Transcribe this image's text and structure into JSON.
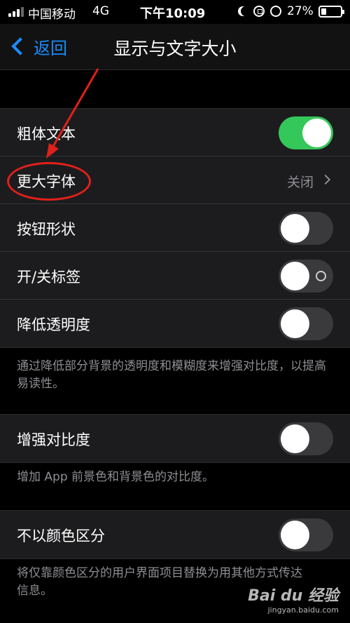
{
  "status_bar": {
    "carrier": "中国移动",
    "network": "4G",
    "time": "下午10:09",
    "battery_percent": "27%",
    "battery_level": 0.27,
    "icons": [
      "signal-icon",
      "moon-icon",
      "rotation-lock-icon",
      "alarm-icon",
      "battery-icon"
    ]
  },
  "nav": {
    "back_label": "返回",
    "title": "显示与文字大小"
  },
  "group1": {
    "rows": [
      {
        "label": "粗体文本",
        "control": "toggle",
        "on": true
      },
      {
        "label": "更大字体",
        "control": "disclosure",
        "value": "关闭"
      },
      {
        "label": "按钮形状",
        "control": "toggle",
        "on": false
      },
      {
        "label": "开/关标签",
        "control": "toggle",
        "on": false,
        "show_onoff_label": true
      },
      {
        "label": "降低透明度",
        "control": "toggle",
        "on": false
      }
    ],
    "footnote": "通过降低部分背景的透明度和模糊度来增强对比度，以提高易读性。"
  },
  "group2": {
    "rows": [
      {
        "label": "增强对比度",
        "control": "toggle",
        "on": false
      }
    ],
    "footnote": "增加 App 前景色和背景色的对比度。"
  },
  "group3": {
    "rows": [
      {
        "label": "不以颜色区分",
        "control": "toggle",
        "on": false
      }
    ],
    "footnote": "将仅靠颜色区分的用户界面项目替换为用其他方式传达信息。"
  },
  "watermark": {
    "logo": "Bai du 经验",
    "url": "jingyan.baidu.com"
  },
  "colors": {
    "accent_blue": "#1a8cff",
    "toggle_on": "#34c759",
    "toggle_off": "#3a3a3c",
    "cell_bg": "#1c1c1e",
    "annotation_red": "#e0201a"
  }
}
